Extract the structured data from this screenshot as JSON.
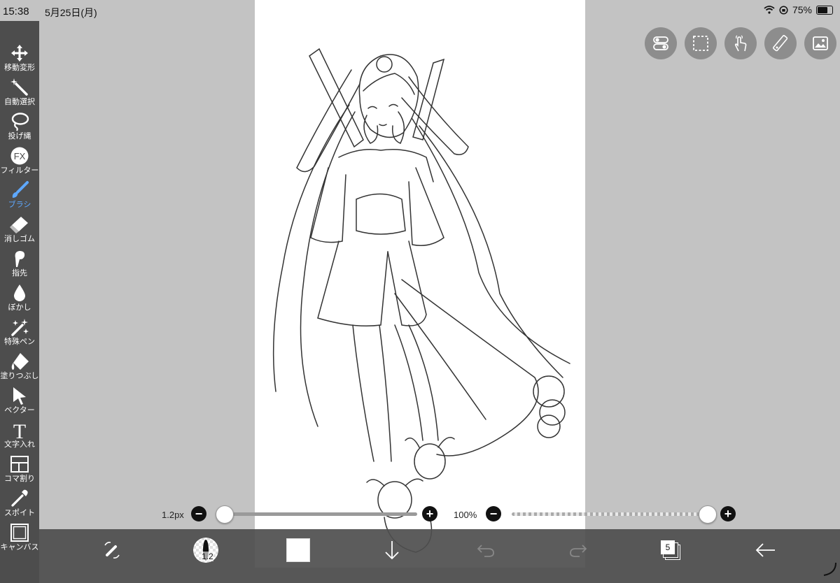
{
  "status": {
    "time": "15:38",
    "date": "5月25日(月)",
    "battery": "75%"
  },
  "toolbar": {
    "items": [
      {
        "label": "移動変形",
        "icon": "move-icon"
      },
      {
        "label": "自動選択",
        "icon": "magic-wand-icon"
      },
      {
        "label": "投げ縄",
        "icon": "lasso-icon"
      },
      {
        "label": "フィルター",
        "icon": "fx-icon",
        "glyph": "FX"
      },
      {
        "label": "ブラシ",
        "icon": "brush-icon",
        "active": true
      },
      {
        "label": "消しゴム",
        "icon": "eraser-icon"
      },
      {
        "label": "指先",
        "icon": "finger-icon"
      },
      {
        "label": "ぼかし",
        "icon": "blur-drop-icon"
      },
      {
        "label": "特殊ペン",
        "icon": "special-pen-icon"
      },
      {
        "label": "塗りつぶし",
        "icon": "fill-bucket-icon"
      },
      {
        "label": "ベクター",
        "icon": "vector-arrow-icon"
      },
      {
        "label": "文字入れ",
        "icon": "text-icon",
        "glyph": "T"
      },
      {
        "label": "コマ割り",
        "icon": "frame-divide-icon"
      },
      {
        "label": "スポイト",
        "icon": "eyedropper-icon"
      },
      {
        "label": "キャンバス",
        "icon": "canvas-icon"
      }
    ]
  },
  "top_actions": [
    "toggle-icon",
    "selection-icon",
    "touch-icon",
    "ruler-icon",
    "image-icon"
  ],
  "brush_size": {
    "label": "1.2px",
    "level": 0.0
  },
  "opacity": {
    "label": "100%",
    "level": 1.0
  },
  "bottom_bar": {
    "brush_size_badge": "1.2",
    "layer_count": "5",
    "color": "#ffffff"
  },
  "colors": {
    "active_tool": "#5ea8ff",
    "toolbar_bg": "#4d4d4d",
    "workspace_bg": "#c3c3c3"
  }
}
